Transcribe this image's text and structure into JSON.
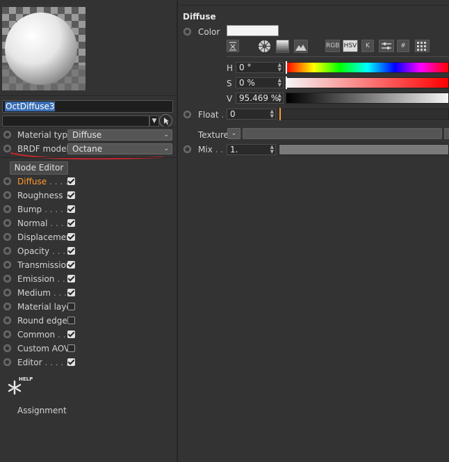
{
  "material": {
    "name": "OctDiffuse3",
    "filter_value": ""
  },
  "left": {
    "material_type_label": "Material type",
    "material_type_value": "Diffuse",
    "brdf_label": "BRDF model",
    "brdf_value": "Octane",
    "node_editor_label": "Node Editor",
    "channels": [
      {
        "label": "Diffuse",
        "dots": ". . . .",
        "checked": true,
        "highlight": true
      },
      {
        "label": "Roughness",
        "dots": ".",
        "checked": true
      },
      {
        "label": "Bump",
        "dots": ". . . . .",
        "checked": true
      },
      {
        "label": "Normal",
        "dots": ". . . .",
        "checked": true
      },
      {
        "label": "Displacement",
        "dots": "",
        "checked": true
      },
      {
        "label": "Opacity",
        "dots": ". . . .",
        "checked": true
      },
      {
        "label": "Transmission",
        "dots": "",
        "checked": true
      },
      {
        "label": "Emission",
        "dots": ". . .",
        "checked": true
      },
      {
        "label": "Medium",
        "dots": ". . .",
        "checked": true
      },
      {
        "label": "Material layer",
        "dots": "",
        "checked": false
      },
      {
        "label": "Round edges",
        "dots": "",
        "checked": false
      },
      {
        "label": "Common",
        "dots": ". .",
        "checked": true
      },
      {
        "label": "Custom AOV",
        "dots": "",
        "checked": false
      },
      {
        "label": "Editor",
        "dots": ". . . . .",
        "checked": true
      }
    ],
    "help_label": "HELP",
    "assignment_label": "Assignment"
  },
  "right": {
    "section_title": "Diffuse",
    "color_label": "Color",
    "color_swatch": "#f4f4f4",
    "color_modes": [
      "RGB",
      "HSV",
      "K",
      "#"
    ],
    "h_label": "H",
    "h_value": "0 °",
    "s_label": "S",
    "s_value": "0 %",
    "v_label": "V",
    "v_value": "95.469 %",
    "float_label": "Float",
    "float_dots": ".",
    "float_value": "0",
    "texture_label": "Texture",
    "mix_label": "Mix",
    "mix_dots": ". .",
    "mix_value": "1."
  },
  "colors": {
    "background": "#333333",
    "highlight_text": "#ff9a2e",
    "selection": "#3b6fb6",
    "annotation": "#c0282d"
  }
}
